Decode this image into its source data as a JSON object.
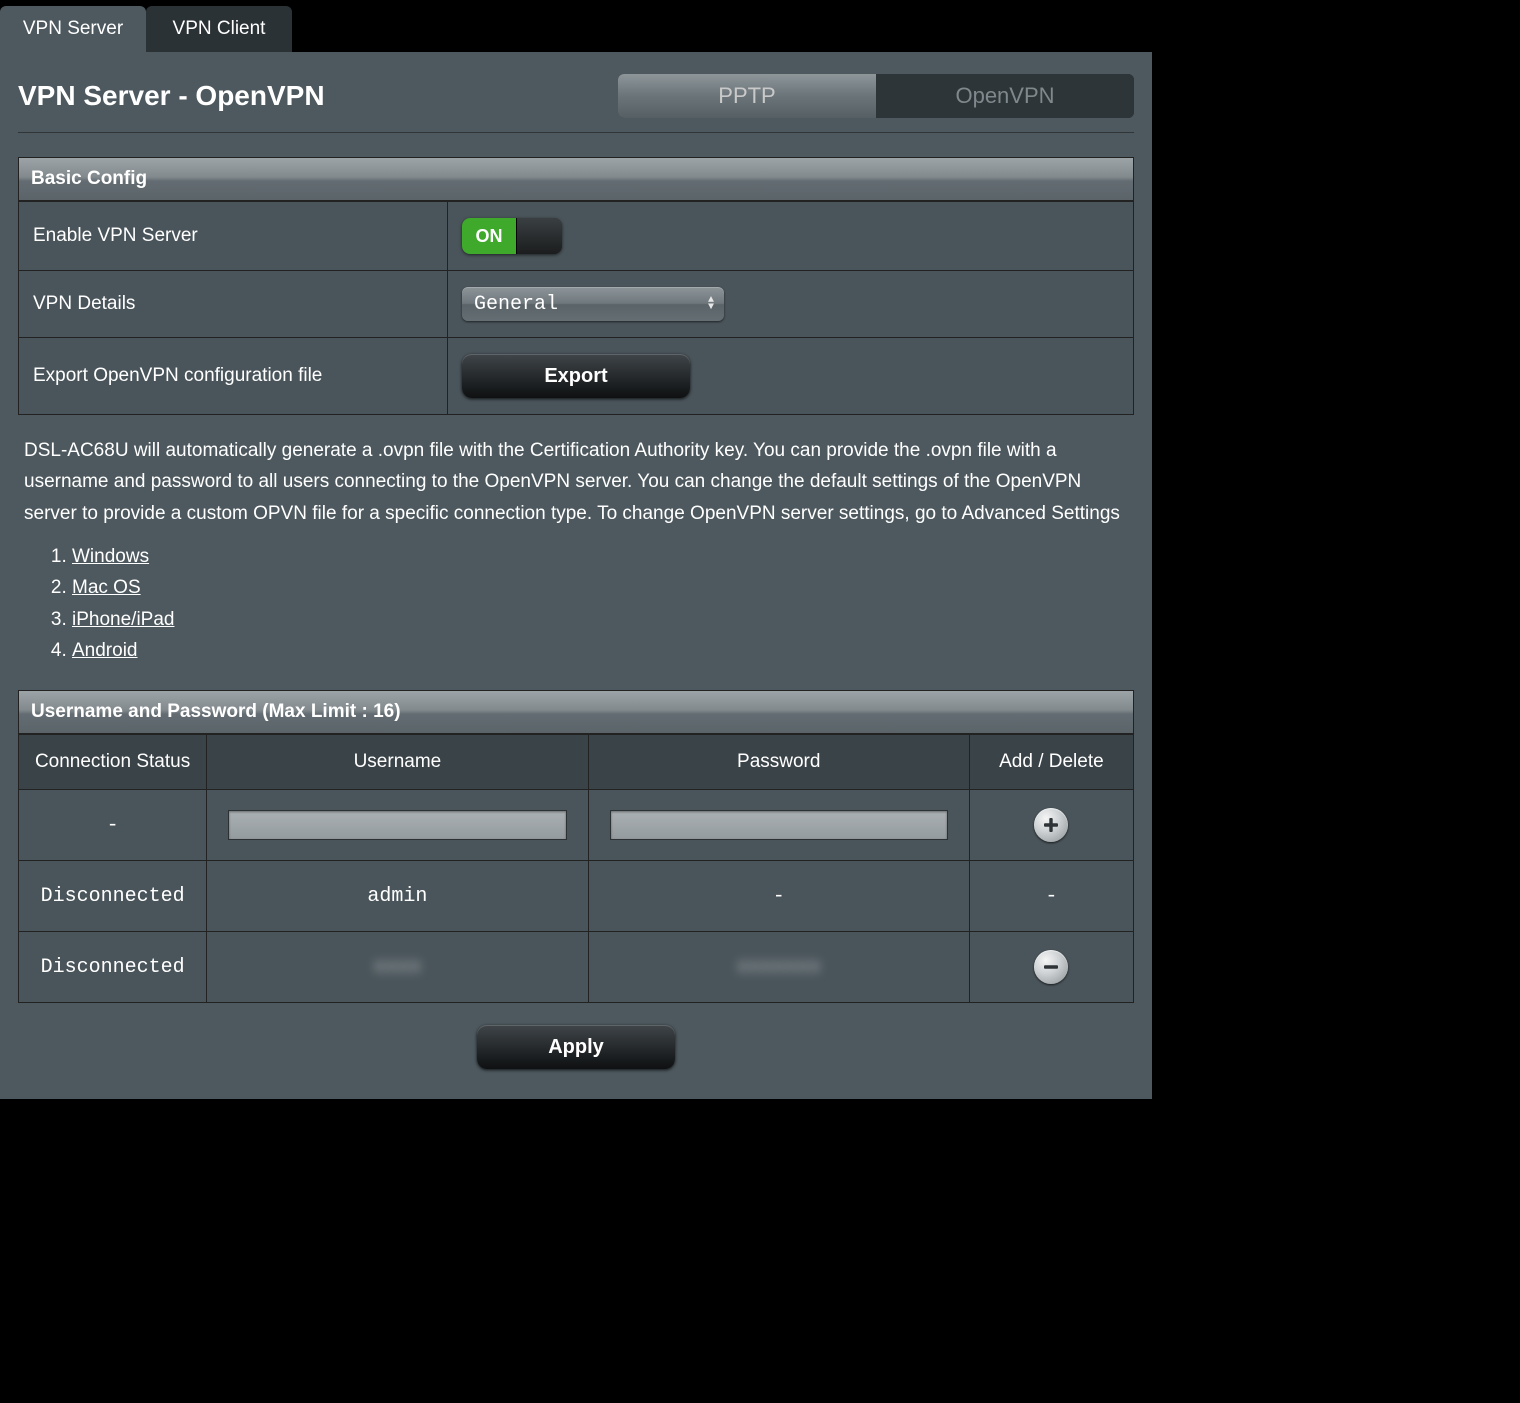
{
  "tabs": {
    "server": "VPN Server",
    "client": "VPN Client"
  },
  "page_title": "VPN Server - OpenVPN",
  "mode_switch": {
    "pptp": "PPTP",
    "openvpn": "OpenVPN"
  },
  "basic_config": {
    "header": "Basic Config",
    "enable_label": "Enable VPN Server",
    "toggle_on": "ON",
    "details_label": "VPN Details",
    "details_value": "General",
    "export_label": "Export OpenVPN configuration file",
    "export_btn": "Export"
  },
  "description": "DSL-AC68U will automatically generate a .ovpn file with the Certification Authority key. You can provide the .ovpn file with a username and password to all users connecting to the OpenVPN server. You can change the default settings of the OpenVPN server to provide a custom OPVN file for a specific connection type. To change OpenVPN server settings, go to Advanced Settings",
  "platforms": [
    "Windows",
    "Mac OS",
    "iPhone/iPad",
    "Android"
  ],
  "users_section": {
    "header": "Username and Password (Max Limit : 16)",
    "cols": {
      "status": "Connection Status",
      "user": "Username",
      "pass": "Password",
      "action": "Add / Delete"
    },
    "new_row": {
      "status": "-",
      "user": "",
      "pass": ""
    },
    "rows": [
      {
        "status": "Disconnected",
        "user": "admin",
        "pass": "-",
        "action": "-",
        "blurred": false,
        "deletable": false
      },
      {
        "status": "Disconnected",
        "user": "xxxx",
        "pass": "xxxxxxx",
        "action": "delete",
        "blurred": true,
        "deletable": true
      }
    ]
  },
  "apply_label": "Apply"
}
